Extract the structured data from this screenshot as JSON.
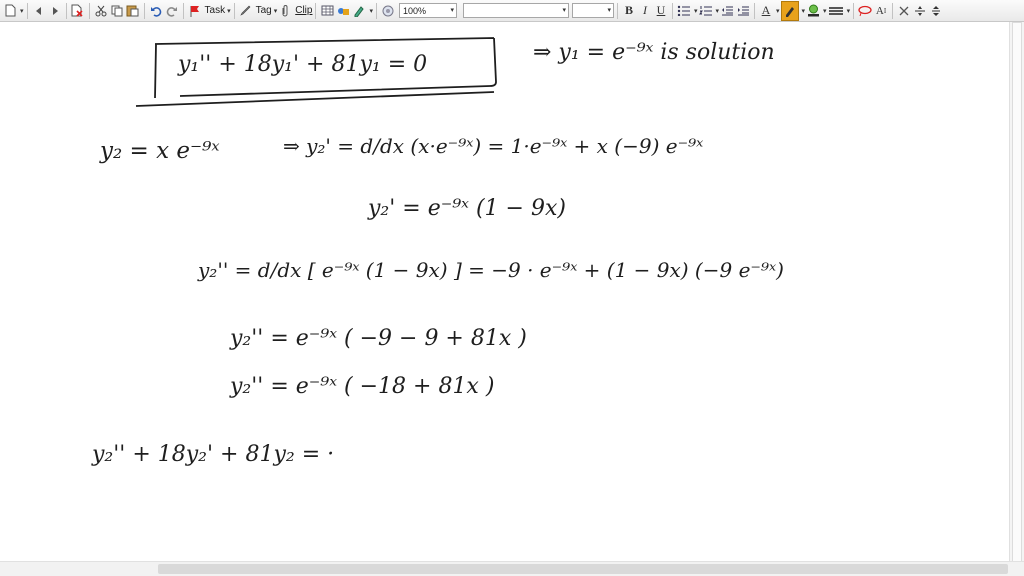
{
  "toolbar": {
    "task_label": "Task",
    "tag_label": "Tag",
    "clip_label": "Clip",
    "zoom_value": "100%",
    "font_name": "",
    "font_size": "",
    "bold": "B",
    "italic": "I",
    "underline": "U",
    "font_color_glyph": "A",
    "accent_color": "#e8a21c"
  },
  "note": {
    "boxed_equation": "y₁'' + 18y₁' + 81y₁ = 0",
    "solution_text": "⇒ y₁ = e⁻⁹ˣ  is solution",
    "line_y2": "y₂ = x e⁻⁹ˣ",
    "line_y2_derivative": "⇒ y₂' = d/dx (x·e⁻⁹ˣ) = 1·e⁻⁹ˣ + x (−9) e⁻⁹ˣ",
    "line_y2_prime": "y₂' = e⁻⁹ˣ (1 − 9x)",
    "line_y2_double_prime": "y₂'' = d/dx [ e⁻⁹ˣ (1 − 9x) ] = −9 · e⁻⁹ˣ + (1 − 9x) (−9 e⁻⁹ˣ)",
    "line_simplify_1": "y₂'' = e⁻⁹ˣ ( −9 − 9 + 81x )",
    "line_simplify_2": "y₂'' = e⁻⁹ˣ ( −18 + 81x )",
    "line_final": "y₂'' + 18y₂' + 81y₂ = ·"
  }
}
